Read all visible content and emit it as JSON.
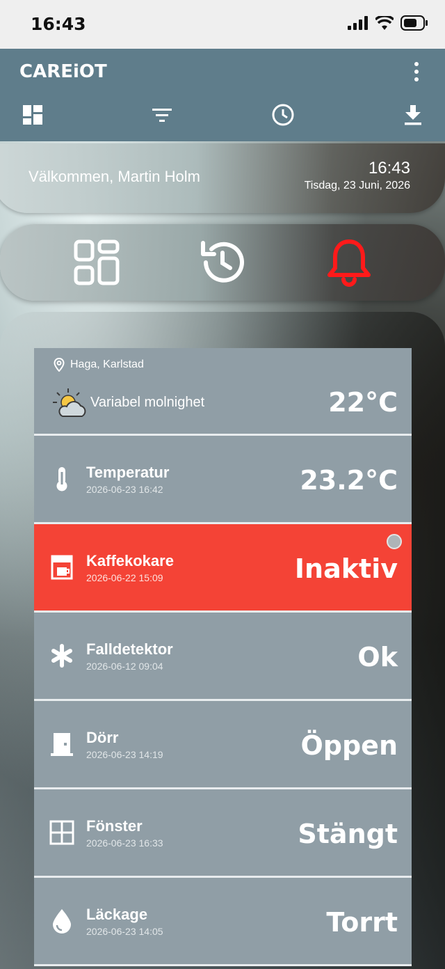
{
  "status_bar": {
    "time": "16:43"
  },
  "app": {
    "title": "CAREiOT"
  },
  "welcome": {
    "greeting": "Välkommen, Martin Holm",
    "time": "16:43",
    "date": "Tisdag, 23 Juni, 2026"
  },
  "weather": {
    "location": "Haga, Karlstad",
    "description": "Variabel molnighet",
    "temperature": "22°C"
  },
  "sensors": [
    {
      "name": "Temperatur",
      "timestamp": "2026-06-23 16:42",
      "value": "23.2°C",
      "icon": "thermometer-icon",
      "alert": false
    },
    {
      "name": "Kaffekokare",
      "timestamp": "2026-06-22 15:09",
      "value": "Inaktiv",
      "icon": "coffee-maker-icon",
      "alert": true
    },
    {
      "name": "Falldetektor",
      "timestamp": "2026-06-12 09:04",
      "value": "Ok",
      "icon": "asterisk-icon",
      "alert": false
    },
    {
      "name": "Dörr",
      "timestamp": "2026-06-23 14:19",
      "value": "Öppen",
      "icon": "door-icon",
      "alert": false
    },
    {
      "name": "Fönster",
      "timestamp": "2026-06-23 16:33",
      "value": "Stängt",
      "icon": "window-icon",
      "alert": false
    },
    {
      "name": "Läckage",
      "timestamp": "2026-06-23 14:05",
      "value": "Torrt",
      "icon": "water-drop-icon",
      "alert": false
    }
  ],
  "colors": {
    "appbar": "#5f7d8b",
    "row": "#909ea6",
    "alert": "#f44336",
    "bell_alert": "#ff1a1a"
  }
}
